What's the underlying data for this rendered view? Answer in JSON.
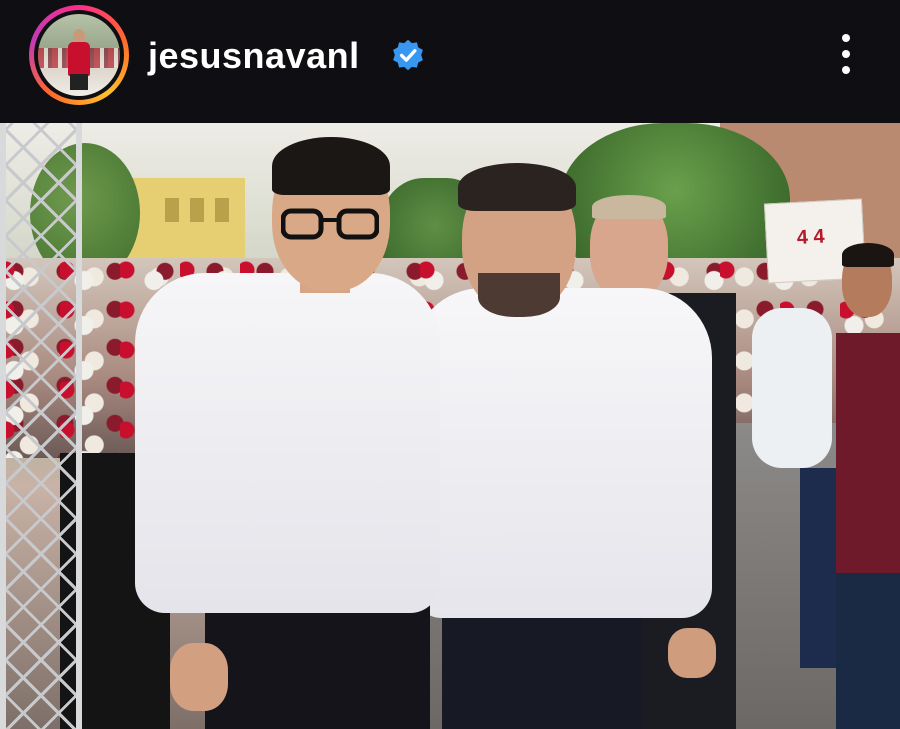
{
  "header": {
    "username": "jesusnavanl",
    "verified": true,
    "avatar_icon": "profile-avatar",
    "more_icon": "more-vertical-icon",
    "verified_icon": "verified-badge-icon"
  },
  "post": {
    "image_icon": "post-photo",
    "banner_text": "4 4"
  },
  "colors": {
    "background": "#0f0f13",
    "text": "#ffffff",
    "verified_blue": "#3897f0",
    "ring_pink": "#ff2d8a",
    "ring_orange": "#ff6a2b",
    "ring_yellow": "#ffc02c"
  }
}
